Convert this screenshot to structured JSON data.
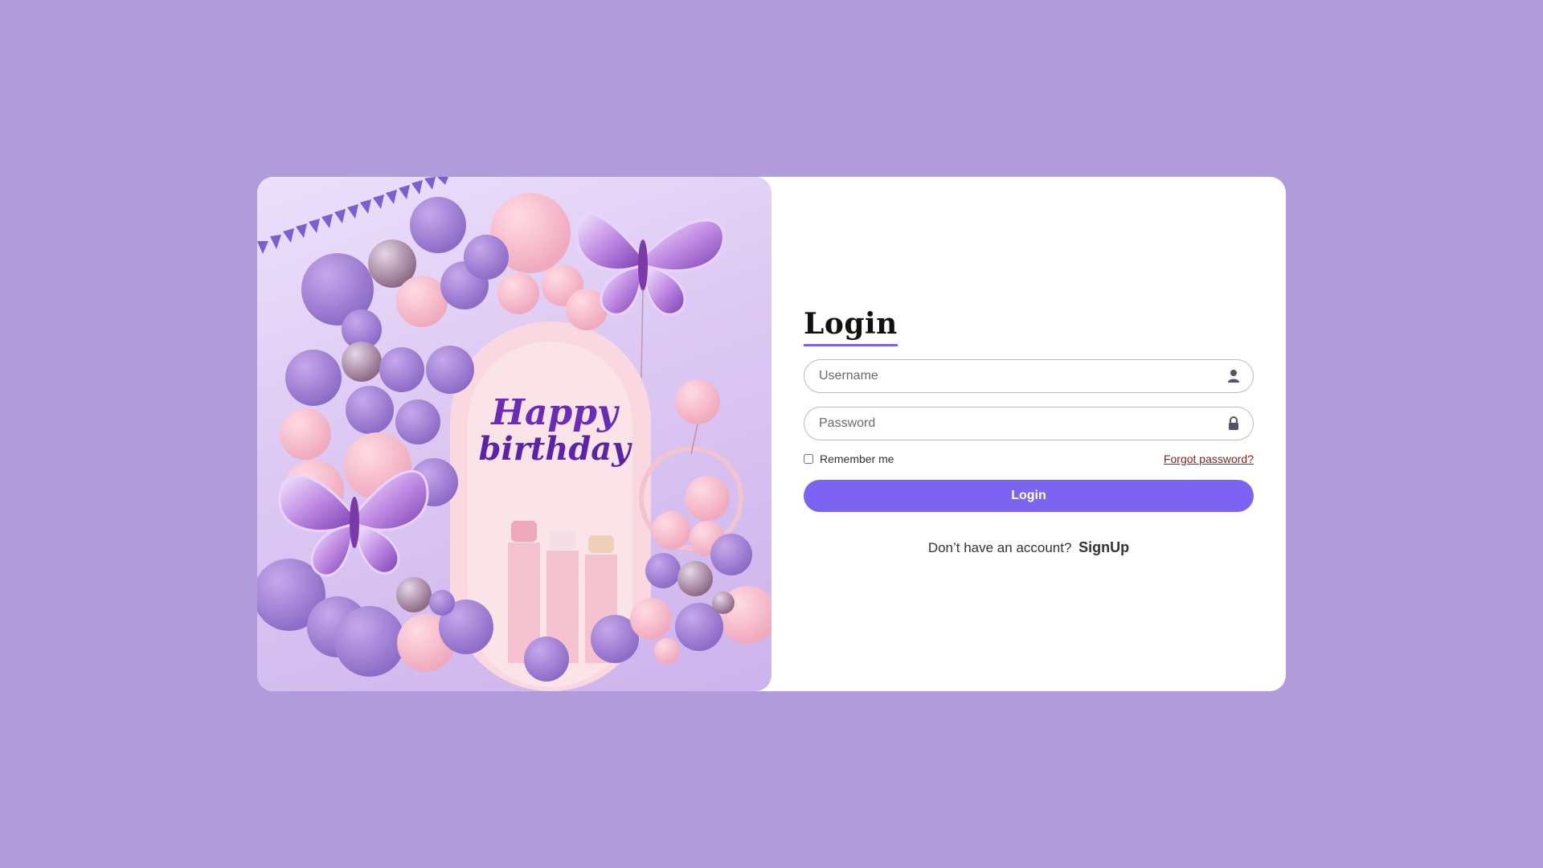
{
  "login": {
    "title": "Login",
    "username_placeholder": "Username",
    "password_placeholder": "Password",
    "remember_label": "Remember me",
    "forgot_label": "Forgot password?",
    "button_label": "Login",
    "signup_prompt": "Don’t have an account?",
    "signup_link": "SignUp"
  },
  "hero": {
    "greeting_line1": "Happy",
    "greeting_line2": "birthday"
  },
  "colors": {
    "background": "#b09cdb",
    "accent": "#7c63f1",
    "forgot_link": "#8a1c1c"
  },
  "icons": {
    "username": "user-icon",
    "password": "lock-icon"
  }
}
